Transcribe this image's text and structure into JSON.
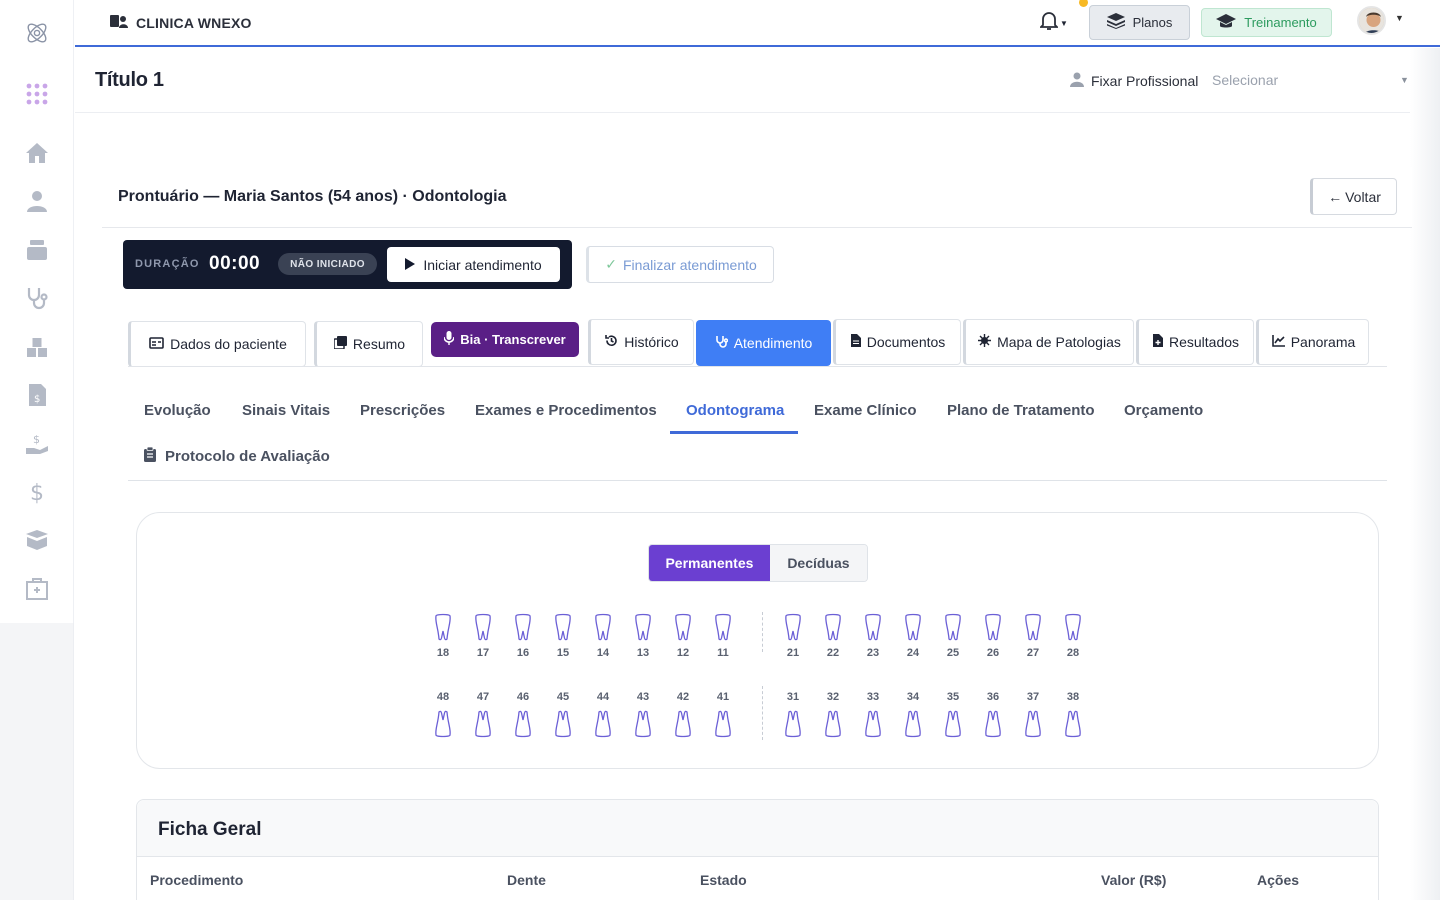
{
  "topbar": {
    "clinic_name": "CLINICA WNEXO",
    "planos_label": "Planos",
    "treinamento_label": "Treinamento"
  },
  "header": {
    "title": "Título 1",
    "fixar_label": "Fixar Profissional",
    "select_placeholder": "Selecionar"
  },
  "record": {
    "title": "Prontuário — Maria Santos (54 anos) · Odontologia",
    "back_label": "Voltar"
  },
  "session": {
    "duration_label": "DURAÇÃO",
    "duration_value": "00:00",
    "status_badge": "NÃO INICIADO",
    "start_label": "Iniciar atendimento",
    "finish_label": "Finalizar atendimento"
  },
  "section_tabs": [
    {
      "label": "Dados do paciente",
      "icon": "id-card-icon"
    },
    {
      "label": "Resumo",
      "icon": "copy-icon"
    },
    {
      "label": "Bia · Transcrever",
      "icon": "microphone-icon"
    },
    {
      "label": "Histórico",
      "icon": "history-icon"
    },
    {
      "label": "Atendimento",
      "icon": "stethoscope-icon"
    },
    {
      "label": "Documentos",
      "icon": "file-icon"
    },
    {
      "label": "Mapa de Patologias",
      "icon": "virus-icon"
    },
    {
      "label": "Resultados",
      "icon": "file-plus-icon"
    },
    {
      "label": "Panorama",
      "icon": "chart-line-icon"
    }
  ],
  "sub_tabs": [
    "Evolução",
    "Sinais Vitais",
    "Prescrições",
    "Exames e Procedimentos",
    "Odontograma",
    "Exame Clínico",
    "Plano de Tratamento",
    "Orçamento",
    "Protocolo de Avaliação"
  ],
  "odontogram": {
    "toggle_permanent": "Permanentes",
    "toggle_deciduous": "Decíduas",
    "upper_right": [
      "18",
      "17",
      "16",
      "15",
      "14",
      "13",
      "12",
      "11"
    ],
    "upper_left": [
      "21",
      "22",
      "23",
      "24",
      "25",
      "26",
      "27",
      "28"
    ],
    "lower_right": [
      "48",
      "47",
      "46",
      "45",
      "44",
      "43",
      "42",
      "41"
    ],
    "lower_left": [
      "31",
      "32",
      "33",
      "34",
      "35",
      "36",
      "37",
      "38"
    ]
  },
  "ficha": {
    "title": "Ficha Geral",
    "columns": [
      "Procedimento",
      "Dente",
      "Estado",
      "Valor (R$)",
      "Ações"
    ]
  },
  "colors": {
    "accent_blue": "#3f7ef5",
    "bia_purple": "#5a1f86",
    "toggle_purple": "#6b3fd1",
    "tooth_outline": "#6b5fd6"
  }
}
